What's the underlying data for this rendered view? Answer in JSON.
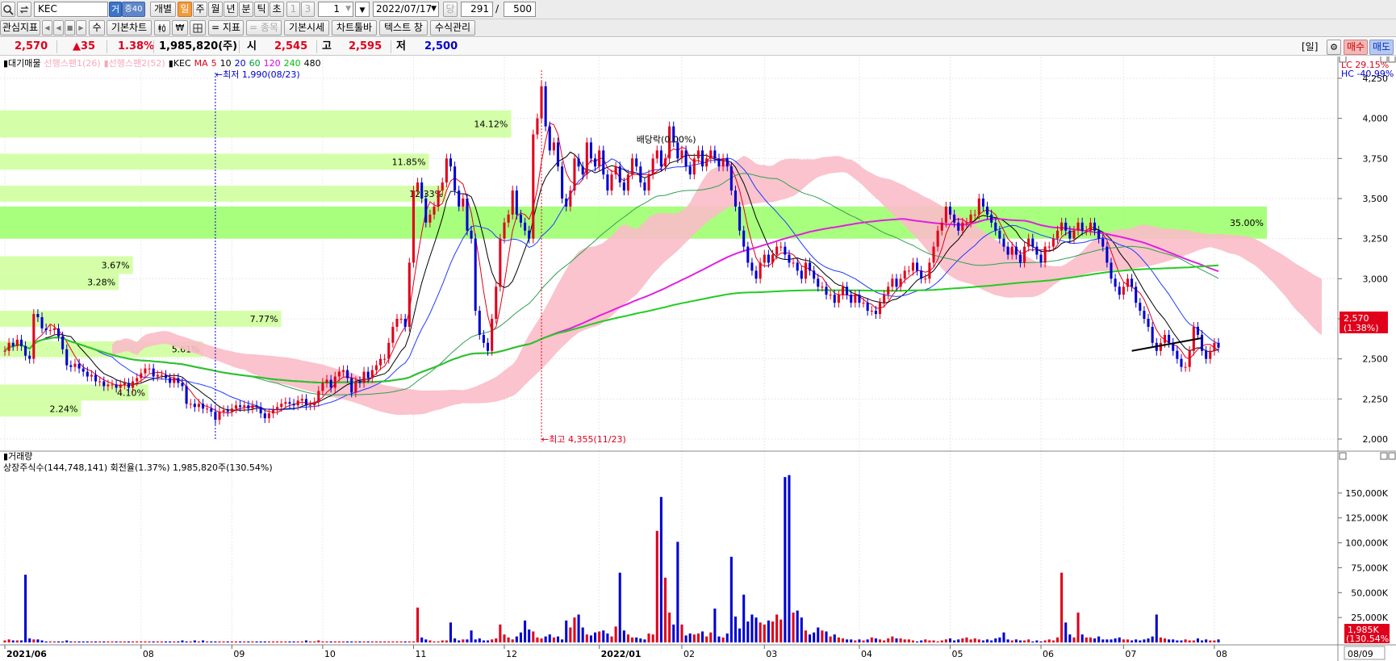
{
  "toolbar": {
    "search_icon": "search-icon",
    "refresh_icon": "refresh-icon",
    "symbol": "KEC",
    "badge_geo": "거",
    "badge_exch": "증40",
    "mode_individual": "개별",
    "periods": [
      "일",
      "주",
      "월",
      "년",
      "분",
      "틱",
      "초"
    ],
    "active_period": "일",
    "n1": "1",
    "n3": "3",
    "step_value": "1",
    "date_value": "2022/07/17",
    "count_label": "당",
    "count_value": "291",
    "slash": "/",
    "total_value": "500"
  },
  "toolbar2": {
    "watch_indicator": "관심지표",
    "nav_buttons": [
      "◀",
      "◀",
      "■",
      "▶"
    ],
    "modify": "수",
    "basic_chart": "기본차트",
    "icon_names": [
      "candles-icon",
      "won-icon",
      "grid-icon"
    ],
    "add_indicator": "= 지표",
    "add_item": "= 종목",
    "basic_quote": "기본시세",
    "chart_toolbar": "차트툴바",
    "text_window": "텍스트 창",
    "formula": "수식관리"
  },
  "quote": {
    "price": "2,570",
    "change": "▲35",
    "rate": "1.38%",
    "volume": "1,985,820(주)",
    "open_label": "시",
    "open": "2,545",
    "high_label": "고",
    "high": "2,595",
    "low_label": "저",
    "low": "2,500",
    "bracket": "[일]",
    "buy": "매수",
    "sell": "매도"
  },
  "legend": {
    "items": [
      {
        "text": "▮대기매물",
        "color": "#000000"
      },
      {
        "text": "선행스팬1(26)",
        "color": "#f7a8b8"
      },
      {
        "text": "▮선행스팬2(52)",
        "color": "#f7a8b8"
      },
      {
        "text": "▮KEC",
        "color": "#000000"
      },
      {
        "text": "MA",
        "color": "#e0001b"
      },
      {
        "text": "5",
        "color": "#e0001b"
      },
      {
        "text": "10",
        "color": "#000000"
      },
      {
        "text": "20",
        "color": "#0000d0"
      },
      {
        "text": "60",
        "color": "#009a3e"
      },
      {
        "text": "120",
        "color": "#e000e0"
      },
      {
        "text": "240",
        "color": "#00c000"
      },
      {
        "text": "480",
        "color": "#000000"
      }
    ],
    "lc": "LC  29.15%",
    "hc": "HC -40.99%",
    "volume_title": "▮거래량",
    "volume_info": "상장주식수(144,748,141) 회전율(1.37%) 1,985,820주(130.54%)"
  },
  "annotations": {
    "low": "←최저 1,990(08/23)",
    "high": "←최고 4,355(11/23)",
    "dividend": "배당락(0.00%)"
  },
  "price_tag": {
    "value": "2,570",
    "rate": "(1.38%)"
  },
  "volume_tag": {
    "value": "1,985K",
    "rate": "(130.54%)"
  },
  "date_tag": "08/09",
  "colors": {
    "up": "#e0001b",
    "down": "#0000d0",
    "profile": "#ccff99",
    "profile_hi": "#99ff66",
    "cloud": "#f9bcc8",
    "ma5": "#e0001b",
    "ma10": "#000000",
    "ma20": "#1f3cff",
    "ma60": "#2ea052",
    "ma120": "#e020e0",
    "ma240": "#22cc22"
  },
  "chart_data": {
    "type": "candlestick",
    "price_axis": {
      "min": 2000,
      "max": 4250,
      "ticks": [
        "2,000",
        "2,250",
        "2,500",
        "2,750",
        "3,000",
        "3,250",
        "3,500",
        "3,750",
        "4,000",
        "4,250"
      ]
    },
    "volume_axis": {
      "ticks": [
        "25,000K",
        "50,000K",
        "75,000K",
        "100,000K",
        "125,000K",
        "150,000K"
      ]
    },
    "x_labels": [
      "2021/06",
      "08",
      "09",
      "10",
      "11",
      "12",
      "2022/01",
      "02",
      "03",
      "04",
      "05",
      "06",
      "07",
      "08"
    ],
    "volume_profile": [
      {
        "lo": 2140,
        "hi": 2240,
        "label": "2.24%"
      },
      {
        "lo": 2240,
        "hi": 2340,
        "label": "4.10%"
      },
      {
        "lo": 2510,
        "hi": 2610,
        "label": "5.61%"
      },
      {
        "lo": 2700,
        "hi": 2800,
        "label": "7.77%"
      },
      {
        "lo": 2930,
        "hi": 3030,
        "label": "3.28%"
      },
      {
        "lo": 3030,
        "hi": 3140,
        "label": "3.67%"
      },
      {
        "lo": 3250,
        "hi": 3450,
        "label": "35.00%"
      },
      {
        "lo": 3480,
        "hi": 3580,
        "label": "12.33%"
      },
      {
        "lo": 3680,
        "hi": 3780,
        "label": "11.85%"
      },
      {
        "lo": 3880,
        "hi": 4050,
        "label": "14.12%"
      }
    ],
    "closes": [
      2550,
      2600,
      2580,
      2620,
      2580,
      2520,
      2500,
      2780,
      2760,
      2690,
      2680,
      2680,
      2690,
      2640,
      2560,
      2460,
      2450,
      2470,
      2440,
      2420,
      2390,
      2400,
      2360,
      2360,
      2330,
      2340,
      2340,
      2320,
      2340,
      2350,
      2320,
      2360,
      2380,
      2410,
      2440,
      2440,
      2390,
      2400,
      2400,
      2380,
      2350,
      2380,
      2350,
      2330,
      2220,
      2220,
      2200,
      2220,
      2190,
      2190,
      2170,
      2120,
      2170,
      2180,
      2170,
      2190,
      2210,
      2200,
      2210,
      2190,
      2210,
      2200,
      2160,
      2130,
      2160,
      2180,
      2200,
      2220,
      2230,
      2220,
      2210,
      2240,
      2250,
      2210,
      2210,
      2230,
      2300,
      2350,
      2370,
      2320,
      2390,
      2420,
      2430,
      2380,
      2290,
      2360,
      2350,
      2420,
      2380,
      2430,
      2460,
      2500,
      2500,
      2600,
      2700,
      2750,
      2750,
      2700,
      3100,
      3550,
      3600,
      3500,
      3350,
      3400,
      3450,
      3550,
      3600,
      3750,
      3700,
      3550,
      3450,
      3500,
      3300,
      3250,
      2800,
      2650,
      2600,
      2550,
      2750,
      2950,
      3250,
      3350,
      3400,
      3550,
      3400,
      3350,
      3300,
      3250,
      3900,
      4000,
      4200,
      3950,
      3800,
      3850,
      3700,
      3500,
      3450,
      3550,
      3750,
      3700,
      3650,
      3850,
      3750,
      3700,
      3800,
      3650,
      3550,
      3650,
      3700,
      3600,
      3550,
      3650,
      3750,
      3700,
      3600,
      3550,
      3650,
      3750,
      3800,
      3700,
      3750,
      3950,
      3850,
      3750,
      3800,
      3700,
      3650,
      3750,
      3800,
      3700,
      3750,
      3800,
      3750,
      3700,
      3750,
      3700,
      3550,
      3450,
      3300,
      3200,
      3100,
      3050,
      3000,
      3100,
      3150,
      3100,
      3150,
      3200,
      3200,
      3150,
      3100,
      3100,
      3050,
      3000,
      3100,
      3050,
      3000,
      2950,
      2950,
      2900,
      2900,
      2850,
      2900,
      2950,
      2900,
      2850,
      2900,
      2850,
      2850,
      2800,
      2800,
      2780,
      2850,
      2900,
      2950,
      3000,
      2950,
      3000,
      3050,
      3050,
      3100,
      3050,
      3000,
      3000,
      3100,
      3200,
      3300,
      3350,
      3450,
      3400,
      3350,
      3300,
      3350,
      3350,
      3400,
      3400,
      3500,
      3450,
      3400,
      3350,
      3300,
      3250,
      3200,
      3150,
      3200,
      3150,
      3100,
      3200,
      3250,
      3200,
      3150,
      3100,
      3200,
      3200,
      3250,
      3300,
      3350,
      3300,
      3250,
      3300,
      3350,
      3300,
      3300,
      3350,
      3300,
      3250,
      3200,
      3100,
      3000,
      2950,
      2900,
      2950,
      3000,
      2950,
      2850,
      2800,
      2750,
      2700,
      2600,
      2550,
      2600,
      2650,
      2600,
      2550,
      2500,
      2450,
      2450,
      2550,
      2700,
      2650,
      2550,
      2500,
      2550,
      2600,
      2570
    ],
    "volumes": [
      2,
      3,
      2,
      2,
      2,
      68,
      4,
      3,
      3,
      2,
      1,
      1,
      1,
      1,
      1,
      2,
      1,
      1,
      1,
      1,
      1,
      1,
      1,
      1,
      1,
      1,
      1,
      1,
      1,
      1,
      1,
      1,
      1,
      1,
      1,
      1,
      1,
      1,
      1,
      1,
      1,
      1,
      1,
      2,
      1,
      1,
      2,
      1,
      2,
      1,
      1,
      1,
      1,
      1,
      1,
      1,
      1,
      1,
      1,
      1,
      1,
      1,
      1,
      1,
      1,
      1,
      1,
      1,
      1,
      1,
      1,
      1,
      1,
      2,
      1,
      1,
      2,
      1,
      1,
      1,
      1,
      1,
      1,
      1,
      1,
      1,
      1,
      1,
      1,
      1,
      1,
      1,
      1,
      1,
      1,
      1,
      1,
      1,
      1,
      1,
      35,
      5,
      3,
      2,
      1,
      1,
      2,
      2,
      20,
      4,
      2,
      3,
      3,
      12,
      3,
      4,
      2,
      2,
      3,
      4,
      18,
      8,
      5,
      3,
      6,
      10,
      22,
      13,
      11,
      5,
      4,
      6,
      8,
      5,
      6,
      3,
      22,
      15,
      25,
      28,
      15,
      8,
      7,
      10,
      11,
      12,
      9,
      6,
      16,
      70,
      12,
      8,
      5,
      5,
      4,
      3,
      9,
      8,
      112,
      146,
      65,
      30,
      18,
      101,
      18,
      7,
      9,
      8,
      9,
      11,
      6,
      10,
      34,
      6,
      5,
      9,
      86,
      26,
      14,
      48,
      21,
      28,
      25,
      20,
      18,
      22,
      21,
      28,
      23,
      166,
      168,
      30,
      32,
      25,
      12,
      8,
      10,
      15,
      12,
      11,
      6,
      8,
      5,
      4,
      3,
      3,
      2,
      3,
      2,
      3,
      5,
      4,
      3,
      2,
      4,
      6,
      4,
      4,
      3,
      3,
      2,
      1,
      2,
      3,
      2,
      2,
      1,
      2,
      3,
      4,
      2,
      3,
      4,
      5,
      3,
      4,
      3,
      2,
      3,
      2,
      4,
      5,
      10,
      3,
      2,
      3,
      2,
      2,
      3,
      1,
      2,
      1,
      2,
      3,
      2,
      5,
      70,
      20,
      8,
      5,
      30,
      8,
      5,
      5,
      4,
      6,
      3,
      3,
      3,
      4,
      5,
      3,
      3,
      2,
      3,
      2,
      3,
      4,
      6,
      28,
      5,
      4,
      3,
      3,
      2,
      2,
      3,
      2,
      2,
      4,
      2,
      3,
      2,
      2,
      3,
      4,
      3,
      4,
      2,
      3,
      2,
      3,
      2,
      2,
      3,
      2,
      3,
      2,
      2,
      3
    ]
  }
}
